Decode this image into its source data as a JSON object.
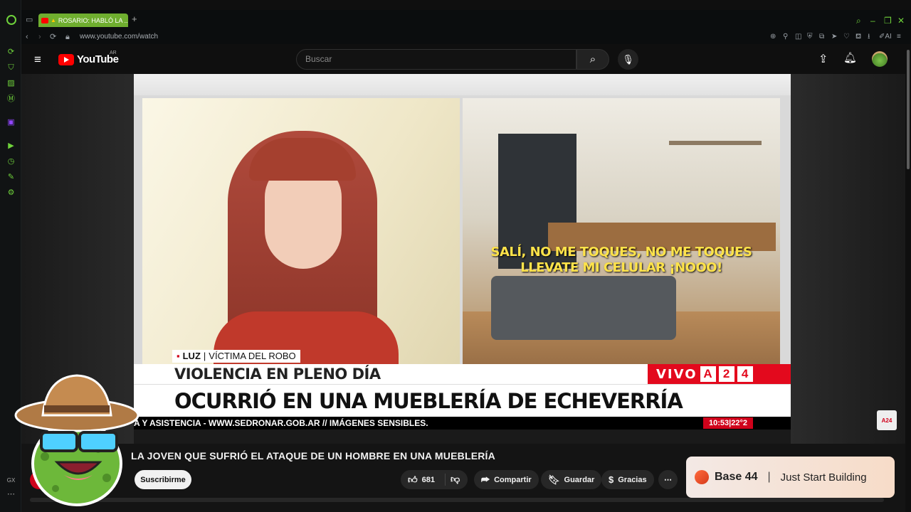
{
  "browser": {
    "tab_title": "ROSARIO: HABLÓ LA ...",
    "address": "www.youtube.com/watch",
    "sidebar_icons": [
      "refresh-icon",
      "bag-icon",
      "ledger-icon",
      "maps-icon",
      "twitch-icon",
      "player-icon",
      "history-icon",
      "extensions-icon",
      "settings-icon",
      "more-icon"
    ],
    "gx_label": "GX",
    "accent_color": "#6fd23b"
  },
  "youtube": {
    "logo_text": "YouTube",
    "region": "AR",
    "search_placeholder": "Buscar"
  },
  "video": {
    "subtitle_line1": "SALÍ, NO ME TOQUES, NO ME TOQUES",
    "subtitle_line2": "LLEVATE MI CELULAR ¡NOOO!",
    "name_label": "LUZ",
    "name_role": "VÍCTIMA DEL ROBO",
    "headline_small": "VIOLENCIA EN PLENO DÍA",
    "live_label": "VIVO",
    "channel_logo_1": "A",
    "channel_logo_2": "2",
    "channel_logo_3": "4",
    "headline_big": "OCURRIÓ EN UNA MUEBLERÍA DE ECHEVERRÍA",
    "ticker": "A Y ASISTENCIA - WWW.SEDRONAR.GOB.AR // IMÁGENES SENSIBLES.",
    "clock": "10:53|22°2"
  },
  "watch": {
    "title": "LA JOVEN QUE SUFRIÓ EL ATAQUE DE UN HOMBRE EN UNA MUEBLERÍA",
    "subscribe_label": "Suscribirme",
    "likes": "681",
    "share_label": "Compartir",
    "save_label": "Guardar",
    "thanks_label": "Gracias"
  },
  "ad": {
    "brand": "Base 44",
    "tagline": "Just Start Building"
  },
  "corner_logo": "A24"
}
